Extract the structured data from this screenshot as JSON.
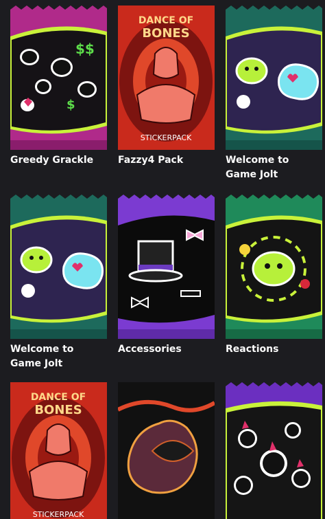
{
  "packs": [
    {
      "label": "Greedy Grackle",
      "art": "ghost-dollar-icons",
      "wrapper_color": "#b02a8a",
      "title_lines": []
    },
    {
      "label": "Fazzy4 Pack",
      "art": "fazzy-character",
      "wrapper_color": "#c92a1c",
      "title_lines": [
        "DANCE OF",
        "BONES"
      ],
      "footer": "STICKERPACK"
    },
    {
      "label": "Welcome to Game Jolt",
      "art": "game-jolt-mascots",
      "wrapper_color": "#1d6a5c",
      "title_lines": []
    },
    {
      "label": "Welcome to Game Jolt",
      "art": "game-jolt-mascots",
      "wrapper_color": "#1d6a5c",
      "title_lines": []
    },
    {
      "label": "Accessories",
      "art": "top-hat-bow",
      "wrapper_color": "#7b3bd1",
      "title_lines": []
    },
    {
      "label": "Reactions",
      "art": "reaction-mascot",
      "wrapper_color": "#1f8a5a",
      "title_lines": []
    },
    {
      "label": "",
      "art": "fazzy-character",
      "wrapper_color": "#c92a1c",
      "title_lines": [
        "DANCE OF",
        "BONES"
      ],
      "footer": "STICKERPACK"
    },
    {
      "label": "",
      "art": "dark-creature",
      "wrapper_color": "#111111",
      "title_lines": []
    },
    {
      "label": "",
      "art": "bat-creatures",
      "wrapper_color": "#6b2fc0",
      "title_lines": []
    }
  ]
}
